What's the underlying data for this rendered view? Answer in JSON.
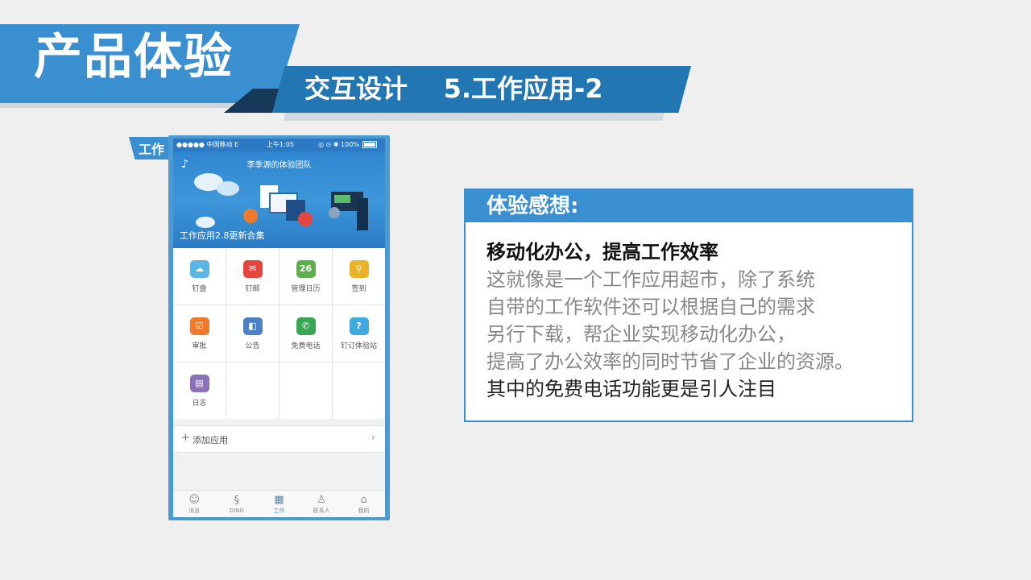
{
  "header": {
    "title": "产品体验",
    "subtitle": "交互设计    5.工作应用-2"
  },
  "phone": {
    "tag": "工作",
    "status": {
      "carrier": "●●●●● 中国移动  E",
      "time": "上午1:05",
      "right": "◎ ⊙ ✱ 100%"
    },
    "hero": {
      "title": "李季源的体验团队",
      "caption": "工作应用2.8更新合集"
    },
    "apps": [
      {
        "label": "钉盘",
        "color": "#5bb6e6",
        "glyph": "☁"
      },
      {
        "label": "钉邮",
        "color": "#e4453c",
        "glyph": "✉"
      },
      {
        "label": "管理日历",
        "color": "#5fae4e",
        "glyph": "26"
      },
      {
        "label": "签到",
        "color": "#e9b42a",
        "glyph": "⚲"
      },
      {
        "label": "审批",
        "color": "#ee7a2b",
        "glyph": "☑"
      },
      {
        "label": "公告",
        "color": "#4c7fc4",
        "glyph": "◧"
      },
      {
        "label": "免费电话",
        "color": "#3aa655",
        "glyph": "✆"
      },
      {
        "label": "钉订体验站",
        "color": "#3fa9e0",
        "glyph": "?"
      },
      {
        "label": "日志",
        "color": "#8b72b6",
        "glyph": "▤"
      }
    ],
    "add_app": {
      "plus": "+",
      "label": "添加应用",
      "chevron": "›"
    },
    "tabs": [
      {
        "label": "消息",
        "icon": "chat-icon"
      },
      {
        "label": "DING",
        "icon": "ding-icon"
      },
      {
        "label": "工作",
        "icon": "grid-icon"
      },
      {
        "label": "联系人",
        "icon": "contacts-icon"
      },
      {
        "label": "我的",
        "icon": "home-icon"
      }
    ]
  },
  "card": {
    "title": "体验感想:",
    "heading": "移动化办公，提高工作效率",
    "lines": [
      "这就像是一个工作应用超市，除了系统",
      "自带的工作软件还可以根据自己的需求",
      "另行下载，帮企业实现移动化办公，",
      "提高了办公效率的同时节省了企业的资源。"
    ],
    "last": "其中的免费电话功能更是引人注目"
  },
  "colors": {
    "accent": "#3a8fd0",
    "accent_dark": "#2277b3",
    "navy": "#16395a"
  }
}
